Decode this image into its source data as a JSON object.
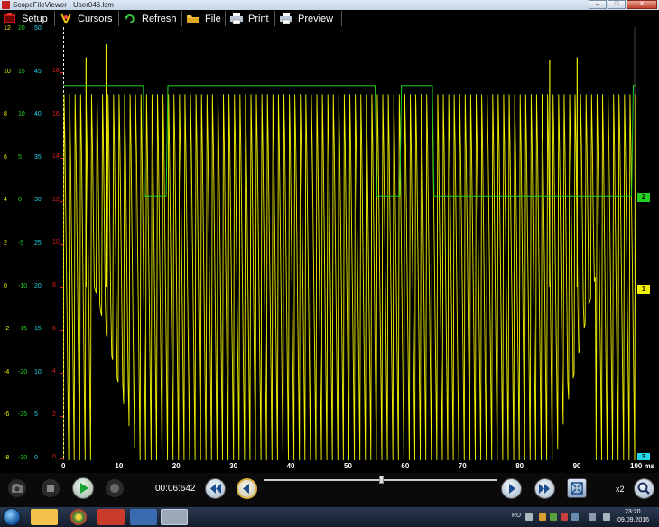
{
  "window": {
    "title": "ScopeFileViewer - User046.lsm",
    "minimize": "–",
    "maximize": "□",
    "close": "✕"
  },
  "toolbar": {
    "setup": "Setup",
    "cursors": "Cursors",
    "refresh": "Refresh",
    "file": "File",
    "print": "Print",
    "preview": "Preview"
  },
  "y_axes": {
    "yellow": [
      "12",
      "10",
      "8",
      "6",
      "4",
      "2",
      "0",
      "-2",
      "-4",
      "-6",
      "-8"
    ],
    "green": [
      "20",
      "15",
      "10",
      "5",
      "0",
      "-5",
      "-10",
      "-15",
      "-20",
      "-25",
      "-30"
    ],
    "cyan": [
      "50",
      "45",
      "40",
      "35",
      "30",
      "25",
      "20",
      "15",
      "10",
      "5",
      "0"
    ],
    "red": [
      "18",
      "16",
      "14",
      "12",
      "10",
      "8",
      "6",
      "4",
      "2",
      "0"
    ]
  },
  "channel_markers": [
    {
      "label": "2",
      "color": "#20d020"
    },
    {
      "label": "1",
      "color": "#f0f000"
    },
    {
      "label": "3",
      "color": "#20d8e8"
    }
  ],
  "time_axis": {
    "ticks": [
      "0",
      "10",
      "20",
      "30",
      "40",
      "50",
      "60",
      "70",
      "80",
      "90",
      "100 ms"
    ]
  },
  "controls": {
    "time": "00:06:642",
    "zoom": "x2"
  },
  "taskbar": {
    "lang": "RU",
    "clock_time": "23:20",
    "clock_date": "09.09.2016"
  },
  "chart_data": {
    "type": "line",
    "xlabel": "",
    "ylabel": "",
    "xlim": [
      0,
      100
    ],
    "x_unit": "ms",
    "ylim_yellow": [
      -8,
      12
    ],
    "series": [
      {
        "name": "1",
        "color": "#f0f000",
        "description_points": {
          "period_ms": 0.96,
          "low": -8.0,
          "high": 8.9,
          "ramp_start_x": [
            5,
            13
          ],
          "ramp_end_x": [
            86,
            93
          ],
          "spikes": [
            [
              4.0,
              10.6
            ],
            [
              7.5,
              11.2
            ],
            [
              85.0,
              10.5
            ],
            [
              89.8,
              10.6
            ]
          ]
        }
      },
      {
        "name": "2",
        "color": "#20d020",
        "steps": [
          {
            "x": 0,
            "y": 9.3
          },
          {
            "x": 14,
            "y": 9.3
          },
          {
            "x": 14.2,
            "y": 4.2
          },
          {
            "x": 18,
            "y": 4.2
          },
          {
            "x": 18.3,
            "y": 9.3
          },
          {
            "x": 54.5,
            "y": 9.3
          },
          {
            "x": 54.8,
            "y": 4.2
          },
          {
            "x": 58.8,
            "y": 4.2
          },
          {
            "x": 59.1,
            "y": 9.3
          },
          {
            "x": 64.5,
            "y": 9.3
          },
          {
            "x": 64.8,
            "y": 4.2
          },
          {
            "x": 99.3,
            "y": 4.2
          },
          {
            "x": 99.6,
            "y": 9.3
          },
          {
            "x": 100,
            "y": 9.3
          }
        ]
      }
    ]
  }
}
